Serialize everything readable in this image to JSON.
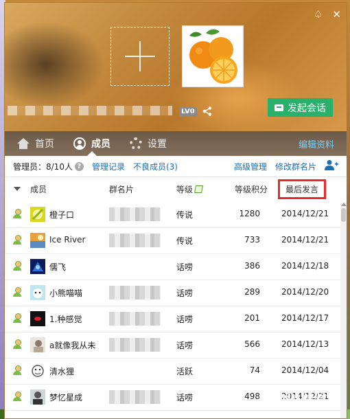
{
  "header": {
    "title_buttons": [
      "♤",
      "✕"
    ],
    "level_badge": "LV0",
    "start_chat_label": "发起会话"
  },
  "tabs": {
    "home": "首页",
    "members": "成员",
    "settings": "设置",
    "edit_profile": "编辑资料"
  },
  "toolbar": {
    "admins": "管理员：8/10人",
    "help_symbol": "?",
    "manage_log": "管理记录",
    "bad_members": "不良成员(3)",
    "advanced_manage": "高级管理",
    "edit_card": "修改群名片",
    "add_member_icon": "add-member-icon"
  },
  "table": {
    "headers": {
      "member": "成员",
      "group_card": "群名片",
      "level": "等级",
      "points": "等级积分",
      "last_post": "最后发言"
    },
    "rows": [
      {
        "name": "橙子口",
        "level": "传说",
        "points": "1280",
        "date": "2014/12/21"
      },
      {
        "name": "Ice River",
        "level": "传说",
        "points": "733",
        "date": "2014/12/21"
      },
      {
        "name": "儒飞",
        "level": "话唠",
        "points": "386",
        "date": "2014/12/18"
      },
      {
        "name": "小熊喵喵",
        "level": "话唠",
        "points": "289",
        "date": "2014/12/20"
      },
      {
        "name": "1.种感觉",
        "level": "话唠",
        "points": "201",
        "date": "2014/12/17"
      },
      {
        "name": "a就像我从未",
        "level": "话唠",
        "points": "566",
        "date": "2014/12/13"
      },
      {
        "name": "清水狸",
        "level": "活跃",
        "points": "74",
        "date": "2014/12/04"
      },
      {
        "name": "梦忆星成",
        "level": "话唠",
        "points": "498",
        "date": "2014/12/21"
      }
    ]
  },
  "colors": {
    "accent_green": "#29b06b",
    "link_blue": "#1a6fb3",
    "highlight_red": "#e52a2a"
  },
  "watermark": "Baidu经验"
}
